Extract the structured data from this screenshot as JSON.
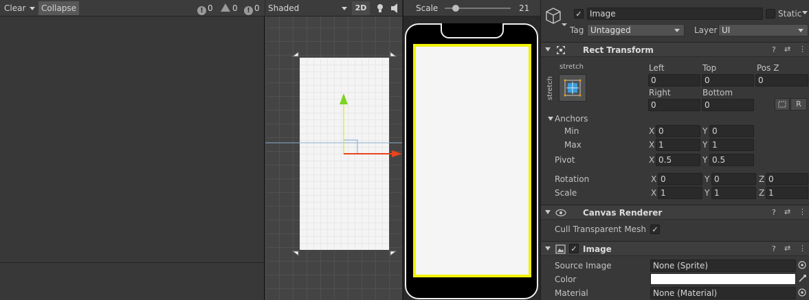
{
  "console": {
    "clear_label": "Clear",
    "collapse_label": "Collapse",
    "log_count": "0",
    "warning_count": "0",
    "error_count": "0"
  },
  "scene": {
    "shading_mode": "Shaded",
    "mode_2d_label": "2D"
  },
  "game": {
    "scale_label": "Scale",
    "scale_value": "21"
  },
  "inspector": {
    "object_name": "Image",
    "static_label": "Static",
    "tag_label": "Tag",
    "tag_value": "Untagged",
    "layer_label": "Layer",
    "layer_value": "UI",
    "rect_transform": {
      "title": "Rect Transform",
      "anchor_h": "stretch",
      "anchor_v": "stretch",
      "left_label": "Left",
      "left_value": "0",
      "top_label": "Top",
      "top_value": "0",
      "posz_label": "Pos Z",
      "posz_value": "0",
      "right_label": "Right",
      "right_value": "0",
      "bottom_label": "Bottom",
      "bottom_value": "0",
      "r_button": "R",
      "anchors_label": "Anchors",
      "min_label": "Min",
      "min_x": "0",
      "min_y": "0",
      "max_label": "Max",
      "max_x": "1",
      "max_y": "1",
      "pivot_label": "Pivot",
      "pivot_x": "0.5",
      "pivot_y": "0.5",
      "rotation_label": "Rotation",
      "rot_x": "0",
      "rot_y": "0",
      "rot_z": "0",
      "scale_label": "Scale",
      "scale_x": "1",
      "scale_y": "1",
      "scale_z": "1",
      "x": "X",
      "y": "Y",
      "z": "Z"
    },
    "canvas_renderer": {
      "title": "Canvas Renderer",
      "cull_label": "Cull Transparent Mesh"
    },
    "image": {
      "title": "Image",
      "source_label": "Source Image",
      "source_value": "None (Sprite)",
      "color_label": "Color",
      "color_value": "#ffffff",
      "material_label": "Material",
      "material_value": "None (Material)"
    }
  },
  "colors": {
    "canvas_border": "#f2f20a",
    "x_axis": "#e8441c",
    "y_axis": "#7ed321",
    "accent": "#3b9bd8"
  }
}
